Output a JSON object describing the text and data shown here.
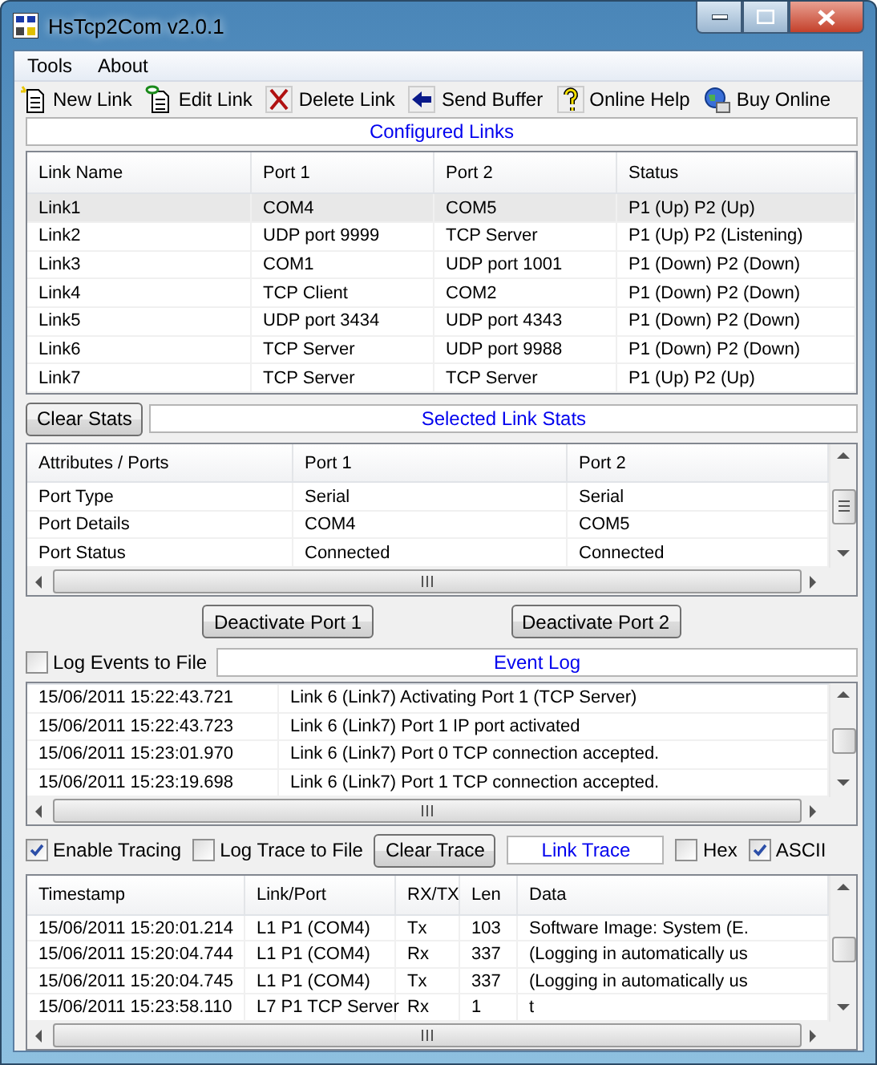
{
  "window": {
    "title": "HsTcp2Com v2.0.1"
  },
  "menu": [
    "Tools",
    "About"
  ],
  "toolbar": [
    "New Link",
    "Edit Link",
    "Delete Link",
    "Send Buffer",
    "Online Help",
    "Buy Online"
  ],
  "links": {
    "caption": "Configured Links",
    "columns": [
      "Link Name",
      "Port 1",
      "Port 2",
      "Status"
    ],
    "rows": [
      {
        "cells": [
          "Link1",
          "COM4",
          "COM5",
          "P1 (Up) P2 (Up)"
        ],
        "selected": true
      },
      {
        "cells": [
          "Link2",
          "UDP port 9999",
          "TCP Server",
          "P1 (Up) P2 (Listening)"
        ],
        "selected": false
      },
      {
        "cells": [
          "Link3",
          "COM1",
          "UDP port 1001",
          "P1 (Down) P2 (Down)"
        ],
        "selected": false
      },
      {
        "cells": [
          "Link4",
          "TCP Client",
          "COM2",
          "P1 (Down) P2 (Down)"
        ],
        "selected": false
      },
      {
        "cells": [
          "Link5",
          "UDP port 3434",
          "UDP port 4343",
          "P1 (Down) P2 (Down)"
        ],
        "selected": false
      },
      {
        "cells": [
          "Link6",
          "TCP Server",
          "UDP port 9988",
          "P1 (Down) P2 (Down)"
        ],
        "selected": false
      },
      {
        "cells": [
          "Link7",
          "TCP Server",
          "TCP Server",
          "P1 (Up) P2 (Up)"
        ],
        "selected": false
      }
    ]
  },
  "stats": {
    "button": "Clear Stats",
    "caption": "Selected Link Stats",
    "columns": [
      "Attributes / Ports",
      "Port 1",
      "Port 2"
    ],
    "rows": [
      [
        "Port Type",
        "Serial",
        "Serial"
      ],
      [
        "Port Details",
        "COM4",
        "COM5"
      ],
      [
        "Port Status",
        "Connected",
        "Connected"
      ]
    ]
  },
  "port_buttons": [
    "Deactivate Port 1",
    "Deactivate Port 2"
  ],
  "event_log": {
    "checkbox": {
      "label": "Log Events to File",
      "checked": false
    },
    "caption": "Event Log",
    "rows": [
      [
        "15/06/2011 15:22:43.721",
        "Link 6 (Link7) Activating Port 1 (TCP Server)"
      ],
      [
        "15/06/2011 15:22:43.723",
        "Link 6 (Link7) Port 1 IP port activated"
      ],
      [
        "15/06/2011 15:23:01.970",
        "Link 6 (Link7) Port 0 TCP connection accepted."
      ],
      [
        "15/06/2011 15:23:19.698",
        "Link 6 (Link7) Port 1 TCP connection accepted."
      ]
    ]
  },
  "trace": {
    "enable": {
      "label": "Enable Tracing",
      "checked": true
    },
    "log_to_file": {
      "label": "Log Trace to File",
      "checked": false
    },
    "button": "Clear Trace",
    "caption": "Link Trace",
    "hex": {
      "label": "Hex",
      "checked": false
    },
    "ascii": {
      "label": "ASCII",
      "checked": true
    },
    "columns": [
      "Timestamp",
      "Link/Port",
      "RX/TX",
      "Len",
      "Data"
    ],
    "rows": [
      [
        "15/06/2011 15:20:01.214",
        "L1 P1 (COM4)",
        "Tx",
        "103",
        "Software Image: System (E."
      ],
      [
        "15/06/2011 15:20:04.744",
        "L1 P1 (COM4)",
        "Rx",
        "337",
        "(Logging in automatically us"
      ],
      [
        "15/06/2011 15:20:04.745",
        "L1 P1 (COM4)",
        "Tx",
        "337",
        "(Logging in automatically us"
      ],
      [
        "15/06/2011 15:23:58.110",
        "L7 P1 TCP Server",
        "Rx",
        "1",
        "t"
      ]
    ]
  }
}
